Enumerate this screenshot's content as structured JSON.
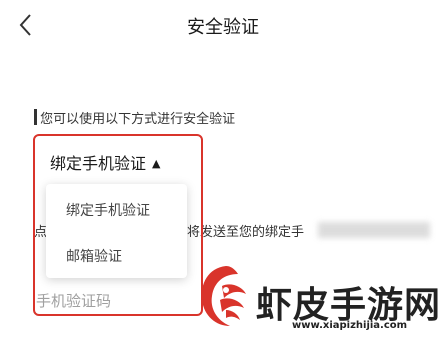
{
  "header": {
    "title": "安全验证",
    "back_icon": "chevron-left-icon"
  },
  "hint": "您可以使用以下方式进行安全验证",
  "selector": {
    "selected": "绑定手机验证",
    "caret_icon": "caret-up-icon"
  },
  "dropdown": {
    "options": [
      {
        "label": "绑定手机验证"
      },
      {
        "label": "邮箱验证"
      }
    ]
  },
  "sms_hint": {
    "prefix": "点",
    "visible_tail": "将发送至您的绑定手"
  },
  "code_input": {
    "placeholder": "手机验证码",
    "value": ""
  },
  "colors": {
    "highlight": "#d9342b",
    "text": "#222222",
    "placeholder": "#a0a0a0"
  },
  "watermark": {
    "brand": "虾皮手游网",
    "url": "www.xiapizhijia.com"
  }
}
